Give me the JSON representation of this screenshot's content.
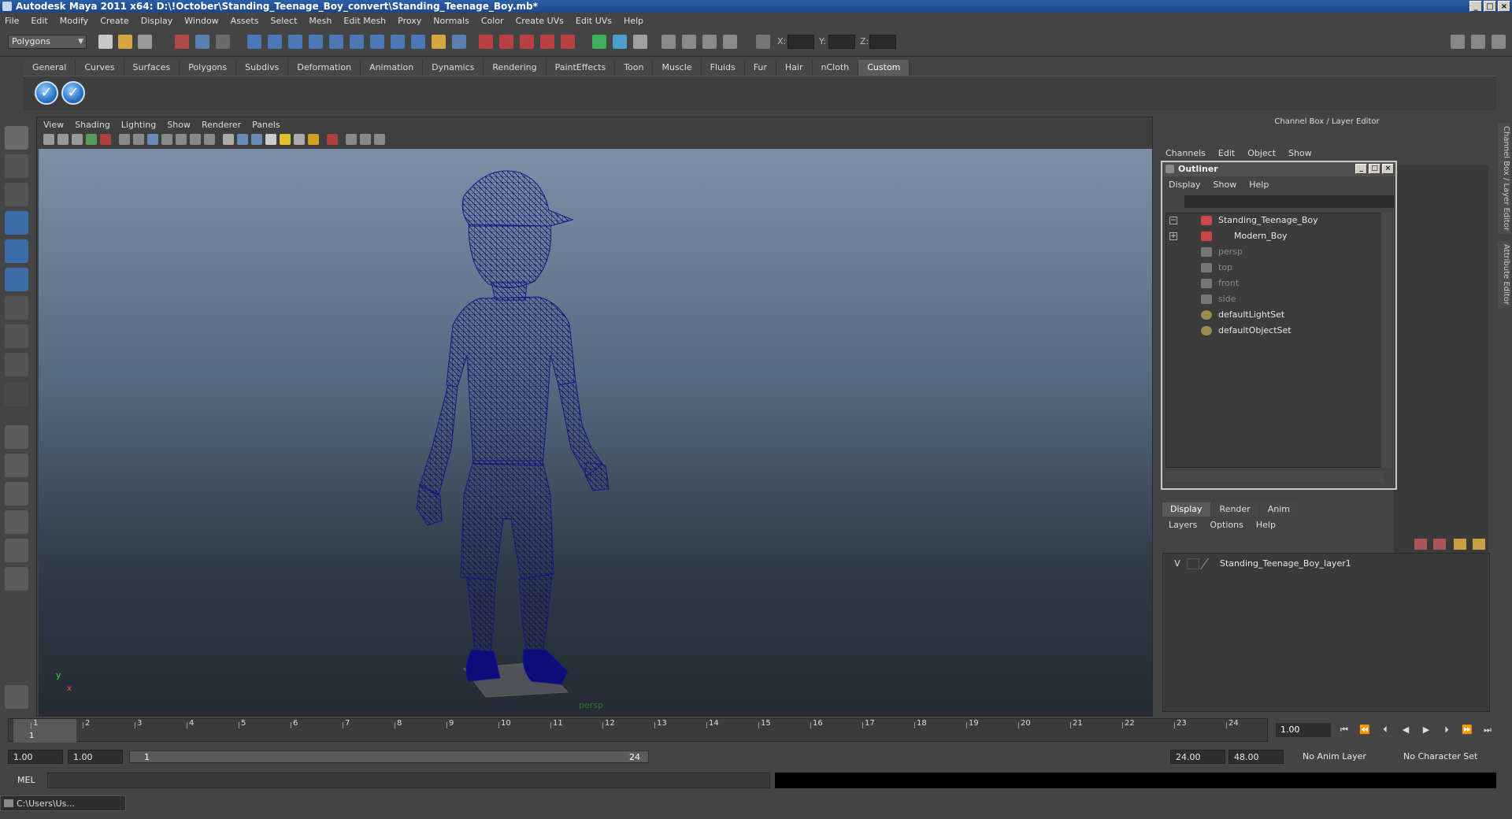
{
  "window": {
    "title": "Autodesk Maya 2011 x64: D:\\!October\\Standing_Teenage_Boy_convert\\Standing_Teenage_Boy.mb*",
    "buttons": [
      "_",
      "□",
      "×"
    ]
  },
  "menubar": [
    "File",
    "Edit",
    "Modify",
    "Create",
    "Display",
    "Window",
    "Assets",
    "Select",
    "Mesh",
    "Edit Mesh",
    "Proxy",
    "Normals",
    "Color",
    "Create UVs",
    "Edit UVs",
    "Help"
  ],
  "statusline": {
    "mode": "Polygons",
    "x_label": "X:",
    "y_label": "Y:",
    "z_label": "Z:"
  },
  "shelf": {
    "tabs": [
      "General",
      "Curves",
      "Surfaces",
      "Polygons",
      "Subdivs",
      "Deformation",
      "Animation",
      "Dynamics",
      "Rendering",
      "PaintEffects",
      "Toon",
      "Muscle",
      "Fluids",
      "Fur",
      "Hair",
      "nCloth",
      "Custom"
    ],
    "active_tab": "Custom",
    "button_glyph": "✓"
  },
  "viewport": {
    "menu": [
      "View",
      "Shading",
      "Lighting",
      "Show",
      "Renderer",
      "Panels"
    ],
    "camera": "persp",
    "axis_y": "y",
    "axis_x": "x"
  },
  "channel_box": {
    "title": "Channel Box / Layer Editor",
    "menu": [
      "Channels",
      "Edit",
      "Object",
      "Show"
    ]
  },
  "outliner": {
    "title": "Outliner",
    "menu": [
      "Display",
      "Show",
      "Help"
    ],
    "items": [
      {
        "label": "Standing_Teenage_Boy",
        "dim": false
      },
      {
        "label": "Modern_Boy",
        "dim": false
      },
      {
        "label": "persp",
        "dim": true
      },
      {
        "label": "top",
        "dim": true
      },
      {
        "label": "front",
        "dim": true
      },
      {
        "label": "side",
        "dim": true
      },
      {
        "label": "defaultLightSet",
        "dim": false
      },
      {
        "label": "defaultObjectSet",
        "dim": false
      }
    ]
  },
  "layer_editor": {
    "tabs": [
      "Display",
      "Render",
      "Anim"
    ],
    "active_tab": "Display",
    "menu": [
      "Layers",
      "Options",
      "Help"
    ],
    "layer": {
      "visible": "V",
      "name": "Standing_Teenage_Boy_layer1"
    }
  },
  "side_tabs": [
    "Channel Box / Layer Editor",
    "Attribute Editor"
  ],
  "timeline": {
    "frames": [
      "1",
      "2",
      "3",
      "4",
      "5",
      "6",
      "7",
      "8",
      "9",
      "10",
      "11",
      "12",
      "13",
      "14",
      "15",
      "16",
      "17",
      "18",
      "19",
      "20",
      "21",
      "22",
      "23",
      "24"
    ],
    "current_frame_label": "1",
    "current_time": "1.00",
    "playback_glyphs": [
      "⏮",
      "⏪",
      "⏴",
      "◀",
      "▶",
      "⏵",
      "⏩",
      "⏭"
    ]
  },
  "range": {
    "start_time": "1.00",
    "playback_start": "1.00",
    "range_start": "1",
    "range_end": "24",
    "playback_end": "24.00",
    "end_time": "48.00",
    "anim_layer": "No Anim Layer",
    "character_set": "No Character Set"
  },
  "command_line": {
    "label": "MEL"
  },
  "minimized_window": {
    "title": "C:\\Users\\Us..."
  },
  "colors": {
    "wireframe": "#1a1a8c",
    "title_bar": "#2c5fa8",
    "panel": "#444444"
  }
}
